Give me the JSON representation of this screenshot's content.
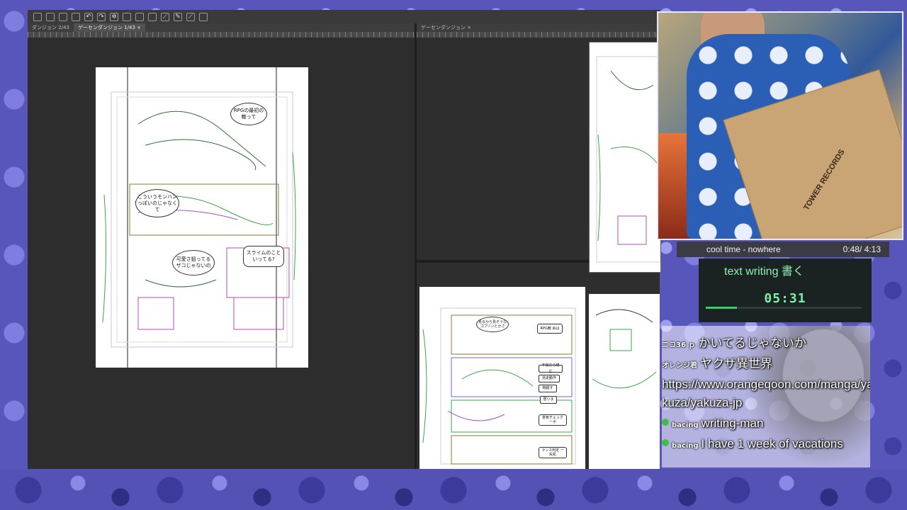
{
  "app": {
    "tabs_left": [
      "ダンジョン 2/43",
      "ゲーセンダンジョン 1/43"
    ],
    "tab_close": "×",
    "tab_right": "ゲーセンダンジョン",
    "main_page": {
      "bubbles": [
        "RPGの最初の敵って",
        "こういうモンハンっぽいのじゃなくて",
        "可愛さ狙ってるザコじゃないの",
        "スライムのこといってる?"
      ]
    },
    "thumb_page": {
      "bubbles": [
        "見るから見そうなゴブリンとかさ",
        "RPG敵 ぬは",
        "不良だら絡む",
        "逃走動作",
        "戦闘す",
        "居りま",
        "意気チェック ーボ",
        "ランス判定 一矢処"
      ]
    }
  },
  "now_playing": {
    "track": "cool time - nowhere",
    "time": "0:48/ 4:13"
  },
  "timer": {
    "title": "text writing 書く",
    "time": "05:31",
    "progress": 0.2
  },
  "webcam": {
    "box_label": "TOWER RECORDS"
  },
  "chat": {
    "messages": [
      {
        "user": "ニコ36 ｐ",
        "text": "かいてるじゃないか",
        "icon": false
      },
      {
        "user": "オレンジ君",
        "text": "ヤクザ異世界",
        "icon": false
      },
      {
        "user": "",
        "text": "https://www.orangeqoon.com/manga/yakuza/yakuza-jp",
        "icon": false
      },
      {
        "user": "bacing",
        "text": "writing-man",
        "icon": true
      },
      {
        "user": "bacing",
        "text": "I have 1 week of vacations",
        "icon": true
      }
    ]
  }
}
